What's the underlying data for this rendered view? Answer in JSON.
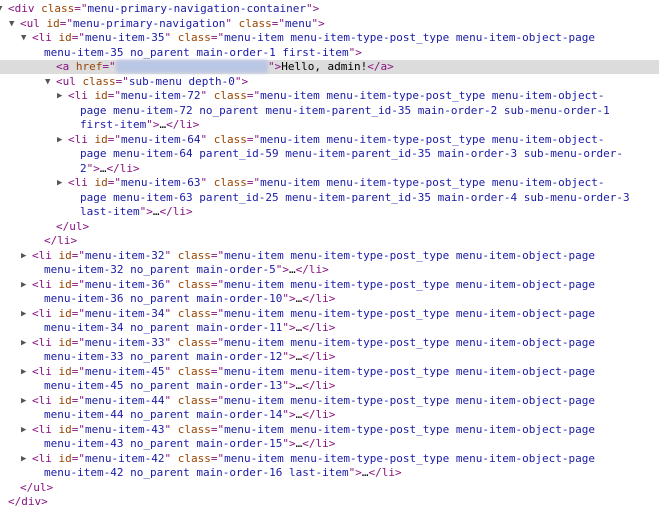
{
  "tree": [
    {
      "indent": 0,
      "twisty": "open",
      "parts": [
        [
          "tag",
          "<div "
        ],
        [
          "an",
          "class"
        ],
        [
          "tag",
          "=\""
        ],
        [
          "av",
          "menu-primary-navigation-container"
        ],
        [
          "tag",
          "\">"
        ]
      ]
    },
    {
      "indent": 1,
      "twisty": "open",
      "parts": [
        [
          "tag",
          "<ul "
        ],
        [
          "an",
          "id"
        ],
        [
          "tag",
          "=\""
        ],
        [
          "av",
          "menu-primary-navigation"
        ],
        [
          "tag",
          "\" "
        ],
        [
          "an",
          "class"
        ],
        [
          "tag",
          "=\""
        ],
        [
          "av",
          "menu"
        ],
        [
          "tag",
          "\">"
        ]
      ]
    },
    {
      "indent": 2,
      "twisty": "open",
      "parts": [
        [
          "tag",
          "<li "
        ],
        [
          "an",
          "id"
        ],
        [
          "tag",
          "=\""
        ],
        [
          "av",
          "menu-item-35"
        ],
        [
          "tag",
          "\" "
        ],
        [
          "an",
          "class"
        ],
        [
          "tag",
          "=\""
        ],
        [
          "av",
          "menu-item menu-item-type-post_type menu-item-object-page"
        ]
      ]
    },
    {
      "indent": 3,
      "parts": [
        [
          "av",
          "menu-item-35 no_parent main-order-1 first-item"
        ],
        [
          "tag",
          "\">"
        ]
      ]
    },
    {
      "indent": 4,
      "highlight": true,
      "parts": [
        [
          "tag",
          "<a "
        ],
        [
          "an",
          "href"
        ],
        [
          "tag",
          "=\""
        ],
        [
          "blur",
          "http://example.com/home"
        ],
        [
          "tag",
          "\">"
        ],
        [
          "txt",
          "Hello, admin!"
        ],
        [
          "tag",
          "</a>"
        ]
      ]
    },
    {
      "indent": 4,
      "twisty": "open",
      "parts": [
        [
          "tag",
          "<ul "
        ],
        [
          "an",
          "class"
        ],
        [
          "tag",
          "=\""
        ],
        [
          "av",
          "sub-menu depth-0"
        ],
        [
          "tag",
          "\">"
        ]
      ]
    },
    {
      "indent": 5,
      "twisty": "closed",
      "parts": [
        [
          "tag",
          "<li "
        ],
        [
          "an",
          "id"
        ],
        [
          "tag",
          "=\""
        ],
        [
          "av",
          "menu-item-72"
        ],
        [
          "tag",
          "\" "
        ],
        [
          "an",
          "class"
        ],
        [
          "tag",
          "=\""
        ],
        [
          "av",
          "menu-item menu-item-type-post_type menu-item-object-"
        ]
      ]
    },
    {
      "indent": 6,
      "parts": [
        [
          "av",
          "page menu-item-72 no_parent menu-item-parent_id-35 main-order-2 sub-menu-order-1"
        ]
      ]
    },
    {
      "indent": 6,
      "parts": [
        [
          "av",
          "first-item"
        ],
        [
          "tag",
          "\">"
        ],
        [
          "txt",
          "…"
        ],
        [
          "tag",
          "</li>"
        ]
      ]
    },
    {
      "indent": 5,
      "twisty": "closed",
      "parts": [
        [
          "tag",
          "<li "
        ],
        [
          "an",
          "id"
        ],
        [
          "tag",
          "=\""
        ],
        [
          "av",
          "menu-item-64"
        ],
        [
          "tag",
          "\" "
        ],
        [
          "an",
          "class"
        ],
        [
          "tag",
          "=\""
        ],
        [
          "av",
          "menu-item menu-item-type-post_type menu-item-object-"
        ]
      ]
    },
    {
      "indent": 6,
      "parts": [
        [
          "av",
          "page menu-item-64 parent_id-59 menu-item-parent_id-35 main-order-3 sub-menu-order-"
        ]
      ]
    },
    {
      "indent": 6,
      "parts": [
        [
          "av",
          "2"
        ],
        [
          "tag",
          "\">"
        ],
        [
          "txt",
          "…"
        ],
        [
          "tag",
          "</li>"
        ]
      ]
    },
    {
      "indent": 5,
      "twisty": "closed",
      "parts": [
        [
          "tag",
          "<li "
        ],
        [
          "an",
          "id"
        ],
        [
          "tag",
          "=\""
        ],
        [
          "av",
          "menu-item-63"
        ],
        [
          "tag",
          "\" "
        ],
        [
          "an",
          "class"
        ],
        [
          "tag",
          "=\""
        ],
        [
          "av",
          "menu-item menu-item-type-post_type menu-item-object-"
        ]
      ]
    },
    {
      "indent": 6,
      "parts": [
        [
          "av",
          "page menu-item-63 parent_id-25 menu-item-parent_id-35 main-order-4 sub-menu-order-3"
        ]
      ]
    },
    {
      "indent": 6,
      "parts": [
        [
          "av",
          "last-item"
        ],
        [
          "tag",
          "\">"
        ],
        [
          "txt",
          "…"
        ],
        [
          "tag",
          "</li>"
        ]
      ]
    },
    {
      "indent": 4,
      "parts": [
        [
          "tag",
          "</ul>"
        ]
      ]
    },
    {
      "indent": 3,
      "parts": [
        [
          "tag",
          "</li>"
        ]
      ]
    },
    {
      "indent": 2,
      "twisty": "closed",
      "parts": [
        [
          "tag",
          "<li "
        ],
        [
          "an",
          "id"
        ],
        [
          "tag",
          "=\""
        ],
        [
          "av",
          "menu-item-32"
        ],
        [
          "tag",
          "\" "
        ],
        [
          "an",
          "class"
        ],
        [
          "tag",
          "=\""
        ],
        [
          "av",
          "menu-item menu-item-type-post_type menu-item-object-page"
        ]
      ]
    },
    {
      "indent": 3,
      "parts": [
        [
          "av",
          "menu-item-32 no_parent main-order-5"
        ],
        [
          "tag",
          "\">"
        ],
        [
          "txt",
          "…"
        ],
        [
          "tag",
          "</li>"
        ]
      ]
    },
    {
      "indent": 2,
      "twisty": "closed",
      "parts": [
        [
          "tag",
          "<li "
        ],
        [
          "an",
          "id"
        ],
        [
          "tag",
          "=\""
        ],
        [
          "av",
          "menu-item-36"
        ],
        [
          "tag",
          "\" "
        ],
        [
          "an",
          "class"
        ],
        [
          "tag",
          "=\""
        ],
        [
          "av",
          "menu-item menu-item-type-post_type menu-item-object-page"
        ]
      ]
    },
    {
      "indent": 3,
      "parts": [
        [
          "av",
          "menu-item-36 no_parent main-order-10"
        ],
        [
          "tag",
          "\">"
        ],
        [
          "txt",
          "…"
        ],
        [
          "tag",
          "</li>"
        ]
      ]
    },
    {
      "indent": 2,
      "twisty": "closed",
      "parts": [
        [
          "tag",
          "<li "
        ],
        [
          "an",
          "id"
        ],
        [
          "tag",
          "=\""
        ],
        [
          "av",
          "menu-item-34"
        ],
        [
          "tag",
          "\" "
        ],
        [
          "an",
          "class"
        ],
        [
          "tag",
          "=\""
        ],
        [
          "av",
          "menu-item menu-item-type-post_type menu-item-object-page"
        ]
      ]
    },
    {
      "indent": 3,
      "parts": [
        [
          "av",
          "menu-item-34 no_parent main-order-11"
        ],
        [
          "tag",
          "\">"
        ],
        [
          "txt",
          "…"
        ],
        [
          "tag",
          "</li>"
        ]
      ]
    },
    {
      "indent": 2,
      "twisty": "closed",
      "parts": [
        [
          "tag",
          "<li "
        ],
        [
          "an",
          "id"
        ],
        [
          "tag",
          "=\""
        ],
        [
          "av",
          "menu-item-33"
        ],
        [
          "tag",
          "\" "
        ],
        [
          "an",
          "class"
        ],
        [
          "tag",
          "=\""
        ],
        [
          "av",
          "menu-item menu-item-type-post_type menu-item-object-page"
        ]
      ]
    },
    {
      "indent": 3,
      "parts": [
        [
          "av",
          "menu-item-33 no_parent main-order-12"
        ],
        [
          "tag",
          "\">"
        ],
        [
          "txt",
          "…"
        ],
        [
          "tag",
          "</li>"
        ]
      ]
    },
    {
      "indent": 2,
      "twisty": "closed",
      "parts": [
        [
          "tag",
          "<li "
        ],
        [
          "an",
          "id"
        ],
        [
          "tag",
          "=\""
        ],
        [
          "av",
          "menu-item-45"
        ],
        [
          "tag",
          "\" "
        ],
        [
          "an",
          "class"
        ],
        [
          "tag",
          "=\""
        ],
        [
          "av",
          "menu-item menu-item-type-post_type menu-item-object-page"
        ]
      ]
    },
    {
      "indent": 3,
      "parts": [
        [
          "av",
          "menu-item-45 no_parent main-order-13"
        ],
        [
          "tag",
          "\">"
        ],
        [
          "txt",
          "…"
        ],
        [
          "tag",
          "</li>"
        ]
      ]
    },
    {
      "indent": 2,
      "twisty": "closed",
      "parts": [
        [
          "tag",
          "<li "
        ],
        [
          "an",
          "id"
        ],
        [
          "tag",
          "=\""
        ],
        [
          "av",
          "menu-item-44"
        ],
        [
          "tag",
          "\" "
        ],
        [
          "an",
          "class"
        ],
        [
          "tag",
          "=\""
        ],
        [
          "av",
          "menu-item menu-item-type-post_type menu-item-object-page"
        ]
      ]
    },
    {
      "indent": 3,
      "parts": [
        [
          "av",
          "menu-item-44 no_parent main-order-14"
        ],
        [
          "tag",
          "\">"
        ],
        [
          "txt",
          "…"
        ],
        [
          "tag",
          "</li>"
        ]
      ]
    },
    {
      "indent": 2,
      "twisty": "closed",
      "parts": [
        [
          "tag",
          "<li "
        ],
        [
          "an",
          "id"
        ],
        [
          "tag",
          "=\""
        ],
        [
          "av",
          "menu-item-43"
        ],
        [
          "tag",
          "\" "
        ],
        [
          "an",
          "class"
        ],
        [
          "tag",
          "=\""
        ],
        [
          "av",
          "menu-item menu-item-type-post_type menu-item-object-page"
        ]
      ]
    },
    {
      "indent": 3,
      "parts": [
        [
          "av",
          "menu-item-43 no_parent main-order-15"
        ],
        [
          "tag",
          "\">"
        ],
        [
          "txt",
          "…"
        ],
        [
          "tag",
          "</li>"
        ]
      ]
    },
    {
      "indent": 2,
      "twisty": "closed",
      "parts": [
        [
          "tag",
          "<li "
        ],
        [
          "an",
          "id"
        ],
        [
          "tag",
          "=\""
        ],
        [
          "av",
          "menu-item-42"
        ],
        [
          "tag",
          "\" "
        ],
        [
          "an",
          "class"
        ],
        [
          "tag",
          "=\""
        ],
        [
          "av",
          "menu-item menu-item-type-post_type menu-item-object-page"
        ]
      ]
    },
    {
      "indent": 3,
      "parts": [
        [
          "av",
          "menu-item-42 no_parent main-order-16 last-item"
        ],
        [
          "tag",
          "\">"
        ],
        [
          "txt",
          "…"
        ],
        [
          "tag",
          "</li>"
        ]
      ]
    },
    {
      "indent": 1,
      "parts": [
        [
          "tag",
          "</ul>"
        ]
      ]
    },
    {
      "indent": 0,
      "parts": [
        [
          "tag",
          "</div>"
        ]
      ]
    }
  ]
}
